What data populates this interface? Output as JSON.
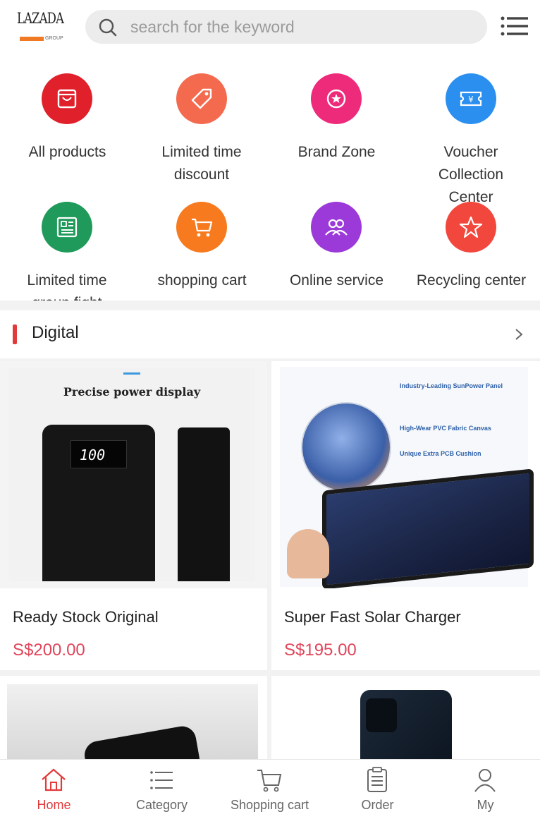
{
  "header": {
    "logo_text": "LAZADA",
    "logo_sub": "GROUP",
    "search_placeholder": "search for the keyword"
  },
  "shortcuts": [
    {
      "label": "All products",
      "color": "#e0202a",
      "icon": "bag-icon"
    },
    {
      "label": "Limited time discount",
      "color": "#f46a4e",
      "icon": "price-tag-icon"
    },
    {
      "label": "Brand Zone",
      "color": "#ee2a7b",
      "icon": "brand-badge-icon"
    },
    {
      "label": "Voucher Collection Center",
      "color": "#2b8fef",
      "icon": "voucher-icon"
    },
    {
      "label": "Limited time group fight",
      "color": "#1f9a5a",
      "icon": "newspaper-icon"
    },
    {
      "label": "shopping cart",
      "color": "#f77a1e",
      "icon": "cart-icon"
    },
    {
      "label": "Online service",
      "color": "#9b3ad8",
      "icon": "people-icon"
    },
    {
      "label": "Recycling center",
      "color": "#f2473d",
      "icon": "star-icon"
    }
  ],
  "section": {
    "title": "Digital"
  },
  "products": [
    {
      "name": "Ready Stock Original",
      "price": "S$200.00",
      "image_caption": "Precise power display",
      "display": "100"
    },
    {
      "name": "Super Fast Solar Charger",
      "price": "S$195.00",
      "image_caption": "Industry-Leading SunPower Panel",
      "image_note_1": "High-Wear PVC Fabric Canvas",
      "image_note_2": "Unique Extra PCB Cushion"
    },
    {
      "name": "",
      "price": ""
    },
    {
      "name": "",
      "price": ""
    }
  ],
  "nav": [
    {
      "label": "Home",
      "icon": "home-icon",
      "active": true
    },
    {
      "label": "Category",
      "icon": "list-icon",
      "active": false
    },
    {
      "label": "Shopping cart",
      "icon": "cart-icon",
      "active": false
    },
    {
      "label": "Order",
      "icon": "order-icon",
      "active": false
    },
    {
      "label": "My",
      "icon": "user-icon",
      "active": false
    }
  ],
  "colors": {
    "accent": "#e23a3a",
    "price": "#e0455a"
  }
}
